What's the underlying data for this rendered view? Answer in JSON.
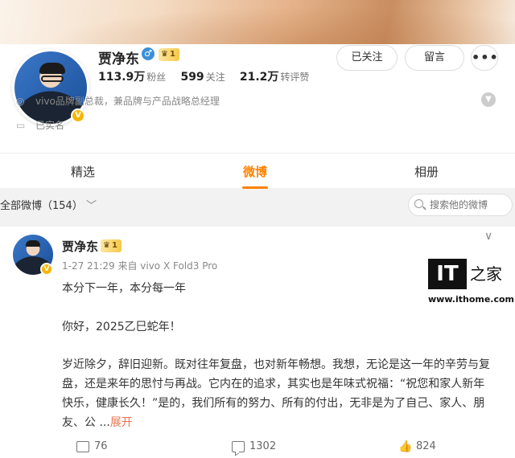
{
  "profile": {
    "name": "贾净东",
    "gender_icon": "male-icon",
    "vip_level": "1",
    "stats": [
      {
        "value": "113.9万",
        "label": "粉丝"
      },
      {
        "value": "599",
        "label": "关注"
      },
      {
        "value": "21.2万",
        "label": "转评赞"
      }
    ],
    "buttons": {
      "follow": "已关注",
      "message": "留言",
      "more": "•••"
    },
    "description": "vivo品牌副总裁，兼品牌与产品战略总经理",
    "verified": "已实名"
  },
  "tabs": [
    {
      "label": "精选",
      "active": false
    },
    {
      "label": "微博",
      "active": true
    },
    {
      "label": "相册",
      "active": false
    }
  ],
  "filter": {
    "label": "全部微博（154）",
    "search_placeholder": "搜索他的微博"
  },
  "post": {
    "author": "贾净东",
    "vip_level": "1",
    "meta": "1-27 21:29  来自 vivo X Fold3 Pro",
    "paragraphs": [
      "本分下一年，本分每一年",
      "你好，2025乙巳蛇年！",
      "岁近除夕，辞旧迎新。既对往年复盘，也对新年畅想。我想，无论是这一年的辛劳与复盘，还是来年的思忖与再战。它内在的追求，其实也是年味式祝福：“祝您和家人新年快乐，健康长久！”是的，我们所有的努力、所有的付出，无非是为了自己、家人、朋友、公 ..."
    ],
    "expand_label": "展开",
    "actions": {
      "repost": "76",
      "comment": "1302",
      "like": "824"
    }
  },
  "watermark": {
    "logo": "IT",
    "char": "之家",
    "url": "www.ithome.com"
  },
  "colors": {
    "accent": "#ff8200",
    "link": "#eb7350",
    "vip_gold": "#f6c94a"
  }
}
